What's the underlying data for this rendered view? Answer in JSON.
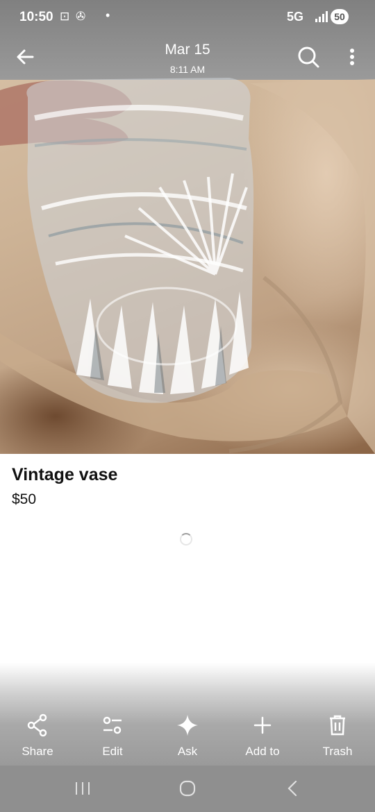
{
  "status_bar": {
    "time": "10:50",
    "notification_icons": "⊡ ✇",
    "dot": "•",
    "network": "5G",
    "battery": "50"
  },
  "header": {
    "date": "Mar 15",
    "time": "8:11 AM",
    "back_icon": "back-arrow-icon",
    "lens_icon": "lens-search-icon",
    "more_icon": "more-vert-icon"
  },
  "item": {
    "title": "Vintage vase",
    "price": "$50"
  },
  "actions": [
    {
      "label": "Share",
      "icon": "share-icon"
    },
    {
      "label": "Edit",
      "icon": "edit-sliders-icon"
    },
    {
      "label": "Ask",
      "icon": "sparkle-icon"
    },
    {
      "label": "Add to",
      "icon": "plus-icon"
    },
    {
      "label": "Trash",
      "icon": "trash-icon"
    }
  ],
  "nav": {
    "recents_icon": "recents-icon",
    "home_icon": "home-icon",
    "back_icon": "back-chevron-icon"
  }
}
